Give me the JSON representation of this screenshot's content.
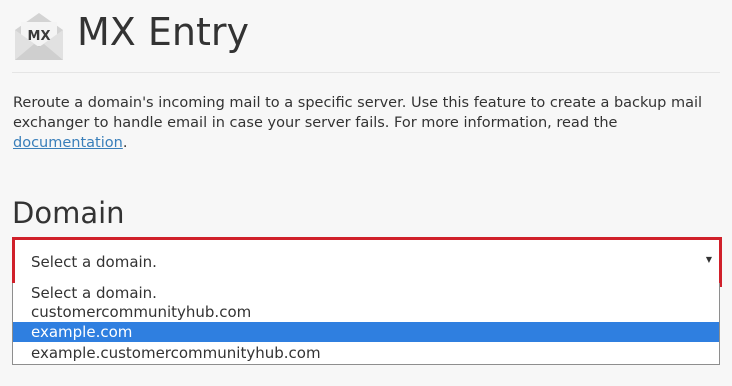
{
  "header": {
    "icon_name": "mx-envelope-icon",
    "icon_text": "MX",
    "title": "MX Entry"
  },
  "intro": {
    "text": "Reroute a domain's incoming mail to a specific server. Use this feature to create a backup mail exchanger to handle email in case your server fails. For more information, read the ",
    "link_text": "documentation",
    "trailing": "."
  },
  "domain_section": {
    "heading": "Domain",
    "select": {
      "value": "Select a domain.",
      "arrow_icon": "caret-down-icon",
      "options": [
        "Select a domain.",
        "customercommunityhub.com",
        "example.com",
        "example.customercommunityhub.com"
      ],
      "highlighted_option": "example.com"
    }
  },
  "colors": {
    "accent_highlight": "#d0202a",
    "selected_option": "#2f7fe0",
    "link": "#3a7fba"
  }
}
